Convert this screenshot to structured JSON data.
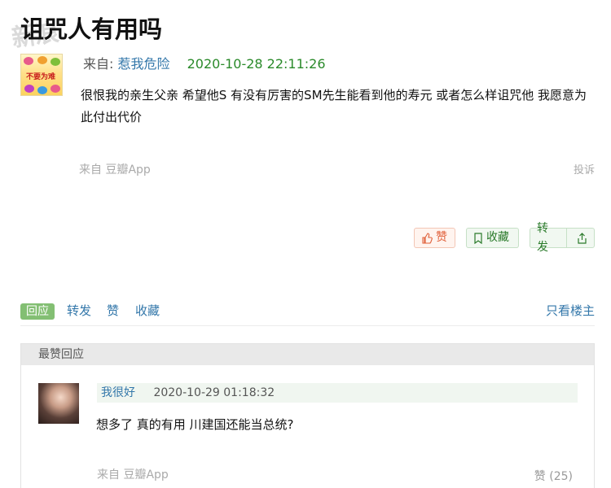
{
  "watermark": "新浪",
  "post": {
    "title": "诅咒人有用吗",
    "avatar_text": "不要为难",
    "from_label": "来自:",
    "author": "惹我危险",
    "timestamp": "2020-10-28 22:11:26",
    "content": "很恨我的亲生父亲 希望他S 有没有厉害的SM先生能看到他的寿元 或者怎么样诅咒他 我愿意为此付出代价",
    "source": "来自 豆瓣App",
    "report_label": "投诉"
  },
  "actions": {
    "like_label": "赞",
    "favorite_label": "收藏",
    "share_label": "转发"
  },
  "tabs": {
    "reply": "回应",
    "share": "转发",
    "like": "赞",
    "favorite": "收藏",
    "only_op": "只看楼主"
  },
  "top_replies": {
    "header": "最赞回应",
    "items": [
      {
        "user": "我很好",
        "timestamp": "2020-10-29 01:18:32",
        "content": "想多了 真的有用 川建国还能当总统?",
        "source": "来自 豆瓣App",
        "likes": "赞 (25)"
      }
    ]
  },
  "colors": {
    "link": "#3377aa",
    "timestamp_green": "#2a8a2a",
    "like_orange": "#e0603a",
    "green_button": "#2a7a2a",
    "active_tab": "#83bf73"
  }
}
